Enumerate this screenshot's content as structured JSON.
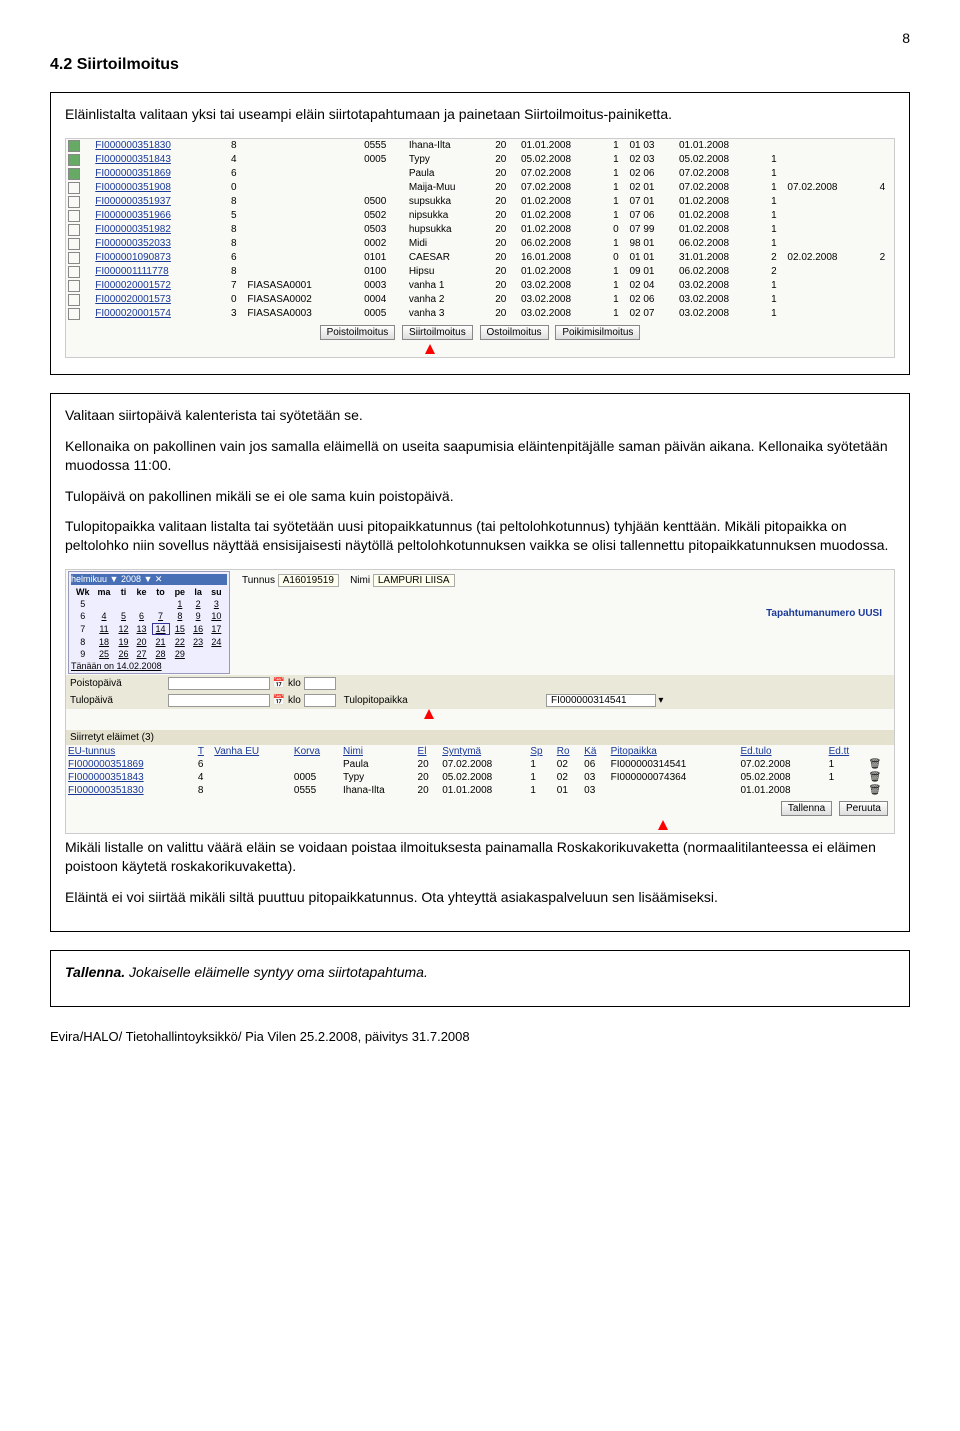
{
  "page": {
    "number": "8"
  },
  "h2": "4.2 Siirtoilmoitus",
  "intro": "Eläinlistalta valitaan yksi tai useampi eläin siirtotapahtumaan ja painetaan Siirtoilmoitus-painiketta.",
  "grid": {
    "rows": [
      [
        "✔",
        "FI000000351830",
        "8",
        "",
        "0555",
        "Ihana-Ilta",
        "20",
        "01.01.2008",
        "1",
        "01 03",
        "01.01.2008",
        "",
        "",
        ""
      ],
      [
        "✔",
        "FI000000351843",
        "4",
        "",
        "0005",
        "Typy",
        "20",
        "05.02.2008",
        "1",
        "02 03",
        "05.02.2008",
        "1",
        "",
        ""
      ],
      [
        "✔",
        "FI000000351869",
        "6",
        "",
        "",
        "Paula",
        "20",
        "07.02.2008",
        "1",
        "02 06",
        "07.02.2008",
        "1",
        "",
        ""
      ],
      [
        "",
        "FI000000351908",
        "0",
        "",
        "",
        "Maija-Muu",
        "20",
        "07.02.2008",
        "1",
        "02 01",
        "07.02.2008",
        "1",
        "07.02.2008",
        "4"
      ],
      [
        "",
        "FI000000351937",
        "8",
        "",
        "0500",
        "supsukka",
        "20",
        "01.02.2008",
        "1",
        "07 01",
        "01.02.2008",
        "1",
        "",
        ""
      ],
      [
        "",
        "FI000000351966",
        "5",
        "",
        "0502",
        "nipsukka",
        "20",
        "01.02.2008",
        "1",
        "07 06",
        "01.02.2008",
        "1",
        "",
        ""
      ],
      [
        "",
        "FI000000351982",
        "8",
        "",
        "0503",
        "hupsukka",
        "20",
        "01.02.2008",
        "0",
        "07 99",
        "01.02.2008",
        "1",
        "",
        ""
      ],
      [
        "",
        "FI000000352033",
        "8",
        "",
        "0002",
        "Midi",
        "20",
        "06.02.2008",
        "1",
        "98 01",
        "06.02.2008",
        "1",
        "",
        ""
      ],
      [
        "",
        "FI000001090873",
        "6",
        "",
        "0101",
        "CAESAR",
        "20",
        "16.01.2008",
        "0",
        "01 01",
        "31.01.2008",
        "2",
        "02.02.2008",
        "2"
      ],
      [
        "",
        "FI000001111778",
        "8",
        "",
        "0100",
        "Hipsu",
        "20",
        "01.02.2008",
        "1",
        "09 01",
        "06.02.2008",
        "2",
        "",
        ""
      ],
      [
        "",
        "FI000020001572",
        "7",
        "FIASASA0001",
        "0003",
        "vanha 1",
        "20",
        "03.02.2008",
        "1",
        "02 04",
        "03.02.2008",
        "1",
        "",
        ""
      ],
      [
        "",
        "FI000020001573",
        "0",
        "FIASASA0002",
        "0004",
        "vanha 2",
        "20",
        "03.02.2008",
        "1",
        "02 06",
        "03.02.2008",
        "1",
        "",
        ""
      ],
      [
        "",
        "FI000020001574",
        "3",
        "FIASASA0003",
        "0005",
        "vanha 3",
        "20",
        "03.02.2008",
        "1",
        "02 07",
        "03.02.2008",
        "1",
        "",
        ""
      ]
    ],
    "buttons": [
      "Poistoilmoitus",
      "Siirtoilmoitus",
      "Ostoilmoitus",
      "Poikimisilmoitus"
    ]
  },
  "middle": {
    "p1": "Valitaan siirtopäivä kalenterista tai syötetään se.",
    "p2": "Kellonaika on pakollinen vain jos samalla eläimellä on useita saapumisia eläintenpitäjälle saman päivän aikana. Kellonaika syötetään muodossa 11:00.",
    "p3": "Tulopäivä on pakollinen mikäli se ei ole sama kuin poistopäivä.",
    "p4": "Tulopitopaikka valitaan listalta tai syötetään uusi pitopaikkatunnus (tai peltolohkotunnus) tyhjään kenttään. Mikäli pitopaikka on peltolohko niin sovellus näyttää ensisijaisesti näytöllä peltolohkotunnuksen vaikka se olisi tallennettu pitopaikkatunnuksen muodossa."
  },
  "form": {
    "cal_month": "helmikuu",
    "cal_year": "2008",
    "cal_days": [
      "Wk",
      "ma",
      "ti",
      "ke",
      "to",
      "pe",
      "la",
      "su"
    ],
    "cal_rows": [
      [
        "5",
        "",
        "",
        "",
        "",
        "1",
        "2",
        "3"
      ],
      [
        "6",
        "4",
        "5",
        "6",
        "7",
        "8",
        "9",
        "10"
      ],
      [
        "7",
        "11",
        "12",
        "13",
        "14",
        "15",
        "16",
        "17"
      ],
      [
        "8",
        "18",
        "19",
        "20",
        "21",
        "22",
        "23",
        "24"
      ],
      [
        "9",
        "25",
        "26",
        "27",
        "28",
        "29",
        "",
        ""
      ]
    ],
    "cal_today": "Tänään on 14.02.2008",
    "tunnus_lbl": "Tunnus",
    "tunnus_val": "A16019519",
    "nimi_lbl": "Nimi",
    "nimi_val": "LAMPURI LIISA",
    "tap_label": "Tapahtumanumero UUSI",
    "poistopaiva": "Poistopäivä",
    "tulopaiva": "Tulopäivä",
    "klo": "klo",
    "tulopitopaikka_lbl": "Tulopitopaikka",
    "tulopitopaikka_val": "FI000000314541",
    "section": "Siirretyt eläimet (3)",
    "cols": [
      "EU-tunnus",
      "T",
      "Vanha EU",
      "Korva",
      "Nimi",
      "El",
      "Syntymä",
      "Sp",
      "Ro",
      "Kä",
      "Pitopaikka",
      "Ed.tulo",
      "Ed.tt"
    ],
    "rows": [
      [
        "FI000000351869",
        "6",
        "",
        "",
        "Paula",
        "20",
        "07.02.2008",
        "1",
        "02",
        "06",
        "FI000000314541",
        "07.02.2008",
        "1"
      ],
      [
        "FI000000351843",
        "4",
        "",
        "0005",
        "Typy",
        "20",
        "05.02.2008",
        "1",
        "02",
        "03",
        "FI000000074364",
        "05.02.2008",
        "1"
      ],
      [
        "FI000000351830",
        "8",
        "",
        "0555",
        "Ihana-Ilta",
        "20",
        "01.01.2008",
        "1",
        "01",
        "03",
        "",
        "01.01.2008",
        ""
      ]
    ],
    "btn_save": "Tallenna",
    "btn_cancel": "Peruuta"
  },
  "tail": {
    "p1": "Mikäli listalle on valittu väärä eläin se voidaan poistaa ilmoituksesta painamalla Roskakorikuvaketta (normaalitilanteessa ei eläimen poistoon käytetä roskakorikuvaketta).",
    "p2": "Eläintä ei voi siirtää mikäli siltä puuttuu pitopaikkatunnus. Ota yhteyttä asiakaspalveluun sen lisäämiseksi."
  },
  "closing": {
    "lead": "Tallenna.",
    "rest": " Jokaiselle eläimelle syntyy oma siirtotapahtuma."
  },
  "footer": "Evira/HALO/ Tietohallintoyksikkö/ Pia Vilen 25.2.2008, päivitys 31.7.2008"
}
